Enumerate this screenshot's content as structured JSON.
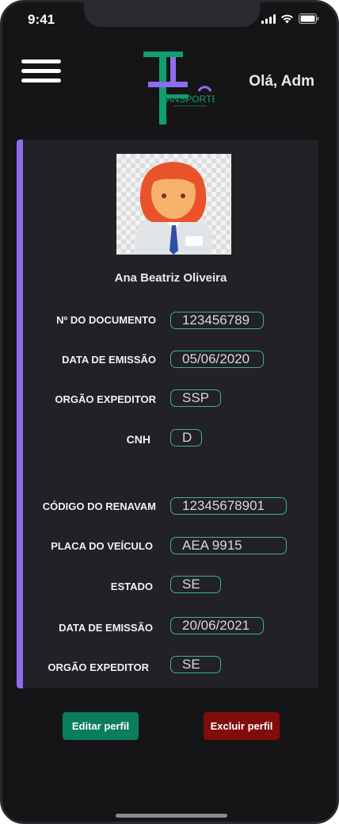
{
  "status_bar": {
    "time": "9:41"
  },
  "header": {
    "greeting": "Olá, Adm",
    "logo_text": "RANSPORTE",
    "logo_colors": {
      "teal": "#0f9f6e",
      "purple": "#8e6cf0"
    }
  },
  "profile": {
    "name": "Ana Beatriz Oliveira",
    "fields": [
      {
        "label": "Nº DO DOCUMENTO",
        "value": "123456789"
      },
      {
        "label": "DATA DE EMISSÃO",
        "value": "05/06/2020"
      },
      {
        "label": "ORGÃO EXPEDITOR",
        "value": "SSP"
      },
      {
        "label": "CNH",
        "value": "D"
      },
      {
        "label": "CÓDIGO DO RENAVAM",
        "value": "12345678901"
      },
      {
        "label": "PLACA DO VEÍCULO",
        "value": "AEA 9915"
      },
      {
        "label": "ESTADO",
        "value": "SE"
      },
      {
        "label": "DATA DE EMISSÃO",
        "value": "20/06/2021"
      },
      {
        "label": "ORGÃO EXPEDITOR",
        "value": "SE"
      }
    ]
  },
  "actions": {
    "edit_label": "Editar perfil",
    "delete_label": "Excluir perfil"
  },
  "colors": {
    "accent_bar": "#8e6cf0",
    "field_border": "#3fb28a",
    "edit_button": "#0a7d5a",
    "delete_button": "#800c0c"
  }
}
